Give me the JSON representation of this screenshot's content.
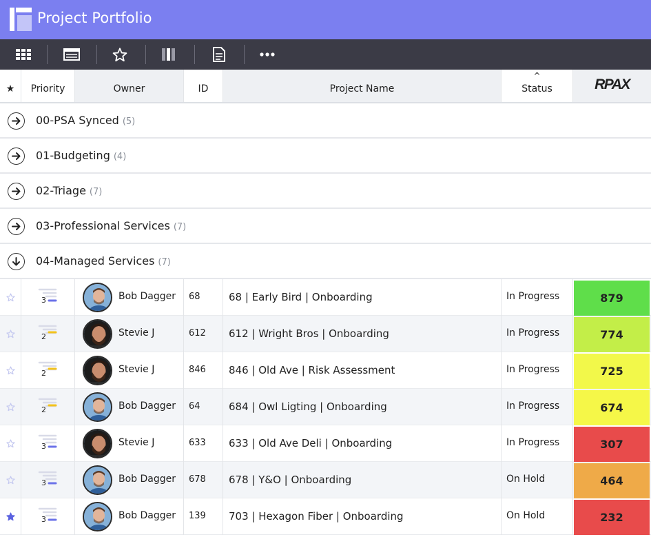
{
  "app": {
    "title": "Project Portfolio"
  },
  "toolbar": {
    "buttons": [
      {
        "icon": "grid-view-icon"
      },
      {
        "icon": "table-view-icon"
      },
      {
        "icon": "star-icon"
      },
      {
        "icon": "columns-icon"
      },
      {
        "icon": "document-icon"
      },
      {
        "icon": "more-icon"
      }
    ]
  },
  "columns": {
    "star": "★",
    "priority": "Priority",
    "owner": "Owner",
    "id": "ID",
    "project_name": "Project Name",
    "status": "Status",
    "score": "RPAX",
    "sort_indicator": "^"
  },
  "groups": [
    {
      "label": "00-PSA Synced",
      "count": "(5)",
      "expanded": false
    },
    {
      "label": "01-Budgeting",
      "count": "(4)",
      "expanded": false
    },
    {
      "label": "02-Triage",
      "count": "(7)",
      "expanded": false
    },
    {
      "label": "03-Professional Services",
      "count": "(7)",
      "expanded": false
    },
    {
      "label": "04-Managed Services",
      "count": "(7)",
      "expanded": true
    }
  ],
  "rows": [
    {
      "starred": false,
      "priority": "3",
      "owner": "Bob Dagger",
      "avatar": "bob",
      "id": "68",
      "project_name": "68 | Early Bird | Onboarding",
      "status": "In Progress",
      "score": "879",
      "score_color": "#5fde4a"
    },
    {
      "starred": false,
      "priority": "2",
      "owner": "Stevie J",
      "avatar": "stevie",
      "id": "612",
      "project_name": "612 | Wright Bros | Onboarding",
      "status": "In Progress",
      "score": "774",
      "score_color": "#c3ee48"
    },
    {
      "starred": false,
      "priority": "2",
      "owner": "Stevie J",
      "avatar": "stevie",
      "id": "846",
      "project_name": "846 | Old Ave | Risk Assessment",
      "status": "In Progress",
      "score": "725",
      "score_color": "#f2f84a"
    },
    {
      "starred": false,
      "priority": "2",
      "owner": "Bob Dagger",
      "avatar": "bob",
      "id": "64",
      "project_name": "684 | Owl Ligting | Onboarding",
      "status": "In Progress",
      "score": "674",
      "score_color": "#f5f748"
    },
    {
      "starred": false,
      "priority": "3",
      "owner": "Stevie J",
      "avatar": "stevie",
      "id": "633",
      "project_name": "633 | Old Ave Deli | Onboarding",
      "status": "In Progress",
      "score": "307",
      "score_color": "#e84b4b"
    },
    {
      "starred": false,
      "priority": "3",
      "owner": "Bob Dagger",
      "avatar": "bob",
      "id": "678",
      "project_name": "678 | Y&O | Onboarding",
      "status": "On Hold",
      "score": "464",
      "score_color": "#efaa48"
    },
    {
      "starred": true,
      "priority": "3",
      "owner": "Bob Dagger",
      "avatar": "bob",
      "id": "139",
      "project_name": "703 | Hexagon Fiber | Onboarding",
      "status": "On Hold",
      "score": "232",
      "score_color": "#e84b4b"
    }
  ],
  "colors": {
    "title_bar": "#7b7ff0",
    "toolbar": "#3b3b46",
    "priority_3": "#6b72e8",
    "priority_2": "#f2c21b",
    "star_inactive": "#c5c9f0",
    "star_active": "#5b62e0"
  }
}
